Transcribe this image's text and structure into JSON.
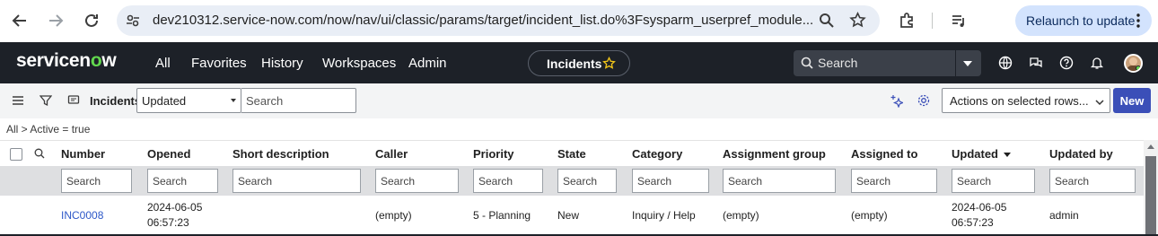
{
  "browser": {
    "url": "dev210312.service-now.com/now/nav/ui/classic/params/target/incident_list.do%3Fsysparm_userpref_module...",
    "relaunch_label": "Relaunch to update"
  },
  "header": {
    "logo_prefix": "servicen",
    "logo_o": "o",
    "logo_suffix": "w",
    "menu": [
      "All",
      "Favorites",
      "History",
      "Workspaces",
      "Admin"
    ],
    "context_pill": "Incidents",
    "search_placeholder": "Search",
    "accent_color": "#62d84e"
  },
  "toolbar": {
    "title": "Incidents",
    "field_select": "Updated",
    "search_placeholder": "Search",
    "actions_select": "Actions on selected rows...",
    "new_label": "New"
  },
  "breadcrumb": "All > Active = true",
  "table": {
    "columns": [
      "Number",
      "Opened",
      "Short description",
      "Caller",
      "Priority",
      "State",
      "Category",
      "Assignment group",
      "Assigned to",
      "Updated",
      "Updated by"
    ],
    "sorted_column": "Updated",
    "column_search_placeholder": "Search",
    "rows": [
      {
        "number": "INC0008",
        "opened_date": "2024-06-05",
        "opened_time": "06:57:23",
        "short_description": "",
        "caller": "(empty)",
        "priority": "5 - Planning",
        "state": "New",
        "category": "Inquiry / Help",
        "assignment_group": "(empty)",
        "assigned_to": "(empty)",
        "updated_date": "2024-06-05",
        "updated_time": "06:57:23",
        "updated_by": "admin"
      }
    ]
  }
}
